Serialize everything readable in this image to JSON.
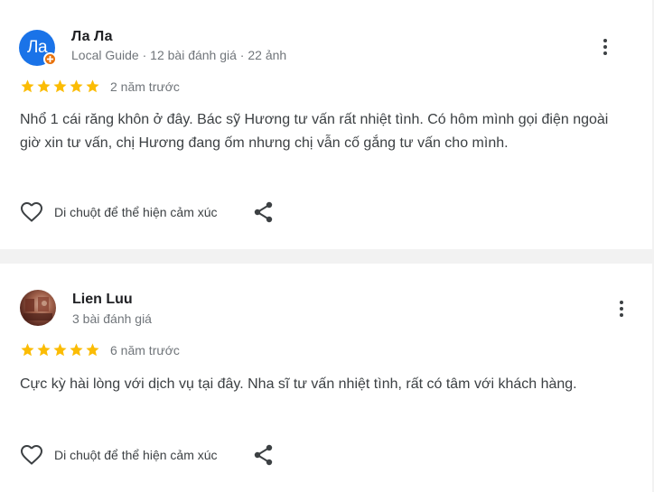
{
  "reviews": [
    {
      "author_name": "Ла Ла",
      "avatar_initials": "Ла",
      "author_meta": "Local Guide · 12 bài đánh giá · 22 ảnh",
      "rating": 5,
      "date": "2 năm trước",
      "text": "Nhổ 1 cái răng khôn ở đây. Bác sỹ Hương tư vấn rất nhiệt tình. Có hôm mình gọi điện ngoài giờ xin tư vấn, chị Hương đang ốm nhưng chị vẫn cố gắng tư vấn cho mình.",
      "reaction_label": "Di chuột để thể hiện cảm xúc"
    },
    {
      "author_name": "Lien Luu",
      "author_meta": "3 bài đánh giá",
      "rating": 5,
      "date": "6 năm trước",
      "text": "Cực kỳ hài lòng với dịch vụ tại đây. Nha sĩ tư vấn nhiệt tình, rất có tâm với khách hàng.",
      "reaction_label": "Di chuột để thể hiện cảm xúc"
    }
  ],
  "colors": {
    "star": "#fbbc04",
    "avatar_bg": "#1a73e8",
    "local_guide_badge": "#e8710a",
    "meta_text": "#70757a"
  },
  "icons": {
    "more": "more-vert-icon",
    "reaction": "heart-outline-icon",
    "share": "share-icon",
    "star": "star-icon",
    "badge": "local-guide-badge-icon"
  }
}
